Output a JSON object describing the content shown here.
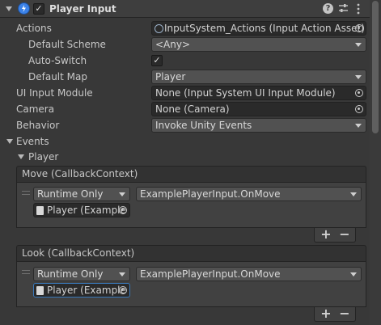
{
  "component": {
    "title": "Player Input",
    "enabled": true
  },
  "fields": {
    "actions_label": "Actions",
    "actions_value": "InputSystem_Actions (Input Action Asset)",
    "default_scheme_label": "Default Scheme",
    "default_scheme_value": "<Any>",
    "auto_switch_label": "Auto-Switch",
    "auto_switch_checked": true,
    "default_map_label": "Default Map",
    "default_map_value": "Player",
    "ui_input_module_label": "UI Input Module",
    "ui_input_module_value": "None (Input System UI Input Module)",
    "camera_label": "Camera",
    "camera_value": "None (Camera)",
    "behavior_label": "Behavior",
    "behavior_value": "Invoke Unity Events"
  },
  "events": {
    "label": "Events",
    "group_label": "Player",
    "items": [
      {
        "title": "Move (CallbackContext)",
        "runtime": "Runtime Only",
        "function": "ExamplePlayerInput.OnMove",
        "target": "Player (Example"
      },
      {
        "title": "Look (CallbackContext)",
        "runtime": "Runtime Only",
        "function": "ExamplePlayerInput.OnMove",
        "target": "Player (Example"
      }
    ]
  },
  "buttons": {
    "plus": "+",
    "minus": "−"
  },
  "icons": {
    "component": "player-input-icon",
    "help": "help-icon",
    "presets": "presets-icon",
    "menu": "kebab-menu-icon",
    "asset": "input-action-asset-icon",
    "script": "script-icon",
    "picker": "object-picker-icon"
  },
  "colors": {
    "background": "#383838",
    "field": "#2a2a2a",
    "dropdown": "#515151",
    "component_icon": "#3b82e8"
  }
}
